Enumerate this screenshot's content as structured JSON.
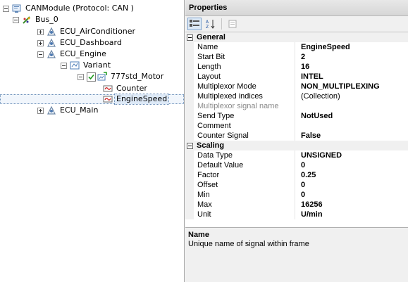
{
  "tree": {
    "root": "CANModule (Protocol: CAN )",
    "bus": "Bus_0",
    "ecus": [
      "ECU_AirConditioner",
      "ECU_Dashboard",
      "ECU_Engine"
    ],
    "variant": "Variant",
    "frame": "777std_Motor",
    "signals": [
      "Counter",
      "EngineSpeed"
    ],
    "ecu_main": "ECU_Main"
  },
  "properties": {
    "header": "Properties",
    "categories": {
      "general": "General",
      "scaling": "Scaling"
    },
    "general_rows": [
      {
        "name": "Name",
        "value": "EngineSpeed"
      },
      {
        "name": "Start Bit",
        "value": "2"
      },
      {
        "name": "Length",
        "value": "16"
      },
      {
        "name": "Layout",
        "value": "INTEL"
      },
      {
        "name": "Multiplexor Mode",
        "value": "NON_MULTIPLEXING"
      },
      {
        "name": "Multiplexed indices",
        "value": "(Collection)"
      },
      {
        "name": "Multiplexor signal name",
        "value": ""
      },
      {
        "name": "Send Type",
        "value": "NotUsed"
      },
      {
        "name": "Comment",
        "value": ""
      },
      {
        "name": "Counter Signal",
        "value": "False"
      }
    ],
    "scaling_rows": [
      {
        "name": "Data Type",
        "value": "UNSIGNED"
      },
      {
        "name": "Default Value",
        "value": "0"
      },
      {
        "name": "Factor",
        "value": "0.25"
      },
      {
        "name": "Offset",
        "value": "0"
      },
      {
        "name": "Min",
        "value": "0"
      },
      {
        "name": "Max",
        "value": "16256"
      },
      {
        "name": "Unit",
        "value": "U/min"
      }
    ],
    "description_title": "Name",
    "description_text": "Unique name of signal within frame"
  },
  "colors": {
    "selection": "#dde9f7",
    "panel_bg": "#f0f0f0"
  }
}
